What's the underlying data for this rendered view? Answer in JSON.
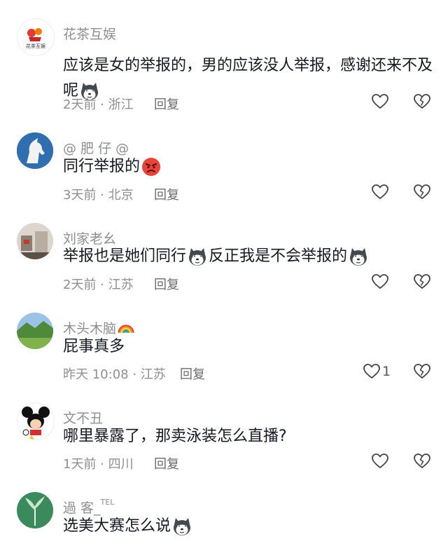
{
  "comments": [
    {
      "username": "花茶互娱",
      "avatar_text": "花茶互娱",
      "text_parts": [
        "应该是女的举报的，男的应该没人举报，感谢还来不及",
        "呢"
      ],
      "emojis": [
        "doge-emoji"
      ],
      "meta": "2天前 · 浙江",
      "reply_label": "回复",
      "like_count": ""
    },
    {
      "username": "@ 肥 仔 @",
      "text_parts": [
        "同行举报的"
      ],
      "emojis": [
        "angry-face-emoji"
      ],
      "meta": "3天前 · 北京",
      "reply_label": "回复",
      "like_count": ""
    },
    {
      "username": "刘家老幺",
      "text_parts": [
        "举报也是她们同行",
        "反正我是不会举报的"
      ],
      "emojis": [
        "doge-emoji",
        "doge-emoji"
      ],
      "meta": "2天前 · 江苏",
      "reply_label": "回复",
      "like_count": ""
    },
    {
      "username": "木头木脑",
      "username_emoji": "rainbow-emoji",
      "text_parts": [
        "屁事真多"
      ],
      "meta": "昨天 10:08 · 江苏",
      "reply_label": "回复",
      "like_count": "1"
    },
    {
      "username": "文不丑",
      "text_parts": [
        "哪里暴露了，那卖泳装怎么直播?"
      ],
      "meta": "1天前 · 四川",
      "reply_label": "回复",
      "like_count": ""
    },
    {
      "username": "過 客_",
      "username_tag": "TEL",
      "text_parts": [
        "选美大赛怎么说"
      ],
      "emojis": [
        "doge-emoji"
      ],
      "meta": "",
      "reply_label": "",
      "like_count": ""
    }
  ],
  "colors": {
    "text": "#161823",
    "secondary": "#8e8e93",
    "accent_avatar_green": "#3a8a5e"
  }
}
